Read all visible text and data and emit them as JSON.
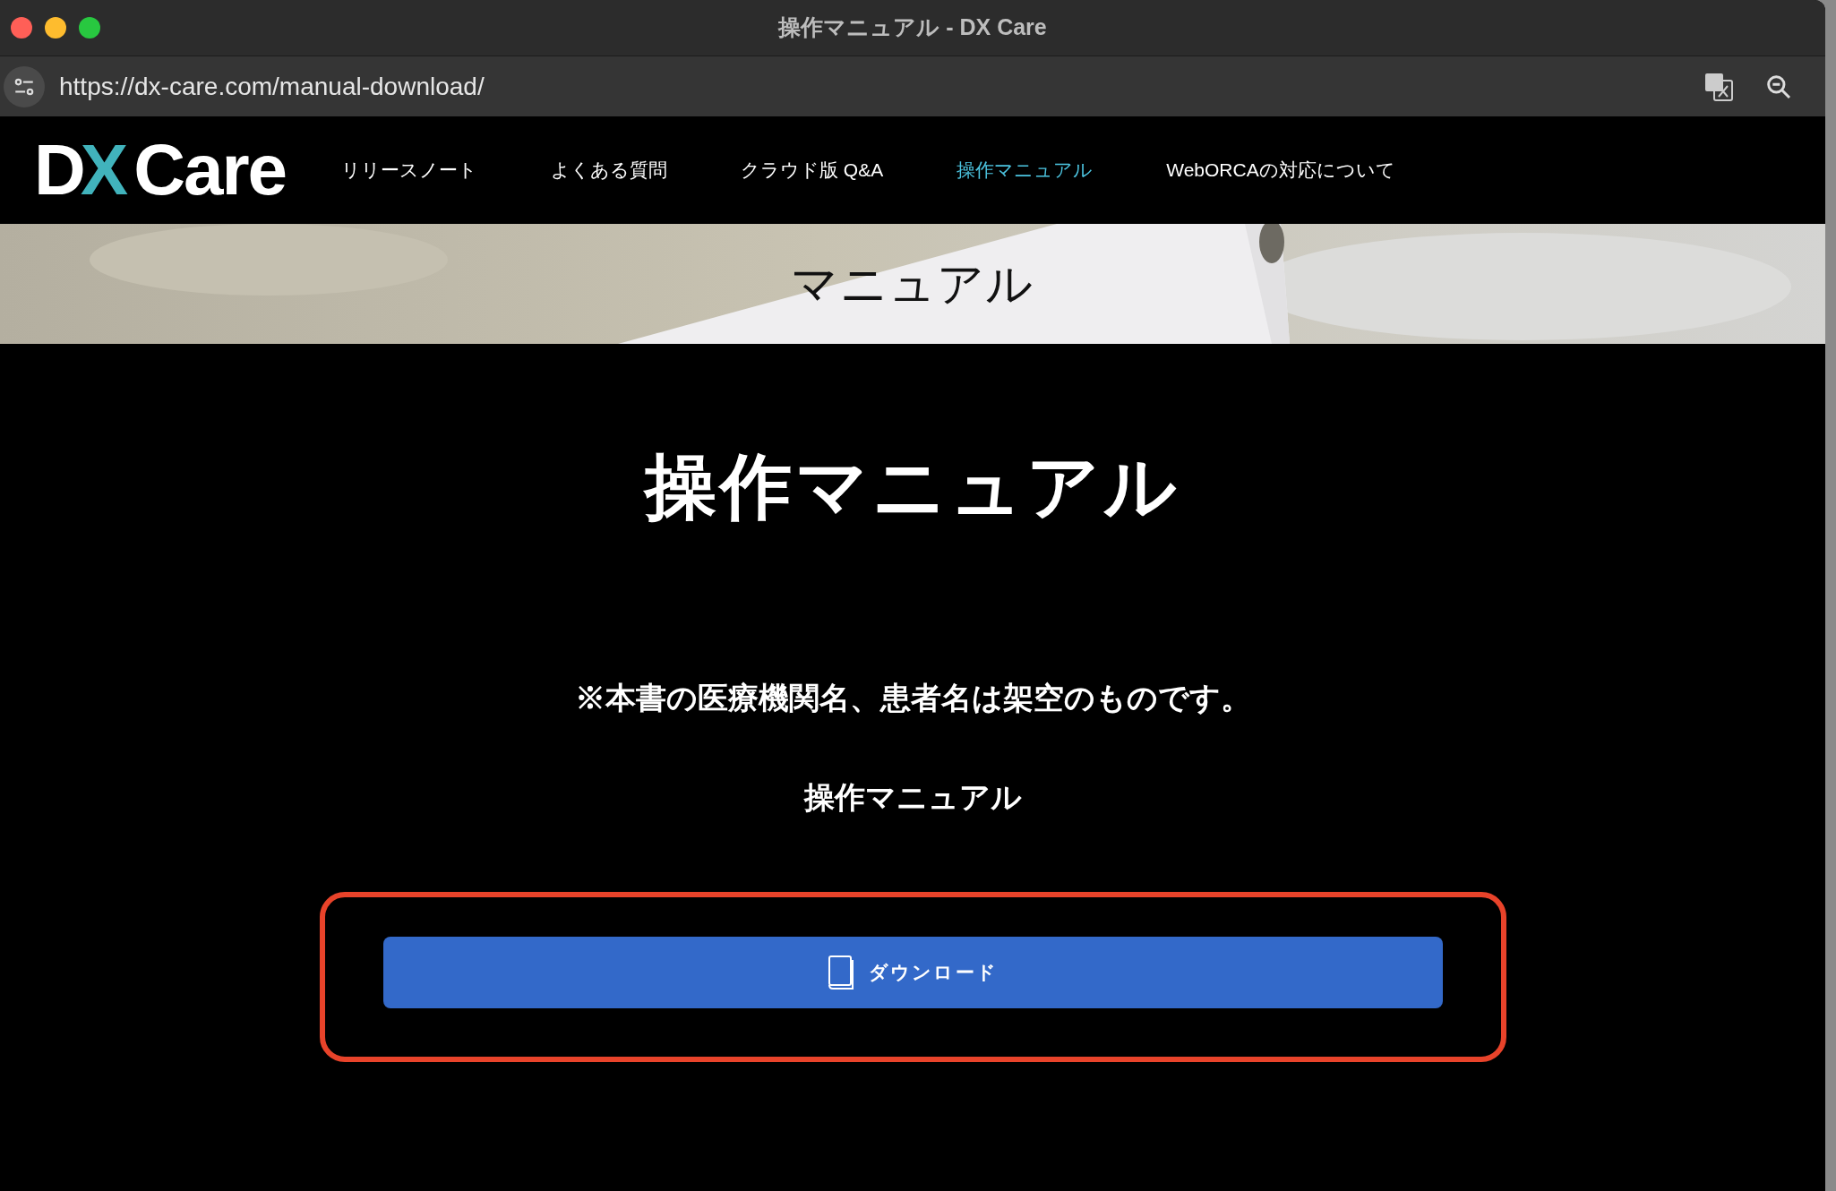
{
  "window": {
    "title": "操作マニュアル - DX Care"
  },
  "address_bar": {
    "url": "https://dx-care.com/manual-download/"
  },
  "site": {
    "logo": {
      "left": "D",
      "mark": "X",
      "right": "Care"
    },
    "nav": [
      {
        "label": "リリースノート",
        "selected": false
      },
      {
        "label": "よくある質問",
        "selected": false
      },
      {
        "label": "クラウド版 Q&A",
        "selected": false
      },
      {
        "label": "操作マニュアル",
        "selected": true
      },
      {
        "label": "WebORCAの対応について",
        "selected": false
      }
    ],
    "banner": {
      "title": "マニュアル"
    },
    "heading": "操作マニュアル",
    "note": "※本書の医療機関名、患者名は架空のものです。",
    "subheading": "操作マニュアル",
    "download_button": {
      "label": "ダウンロード",
      "highlighted": true
    }
  }
}
